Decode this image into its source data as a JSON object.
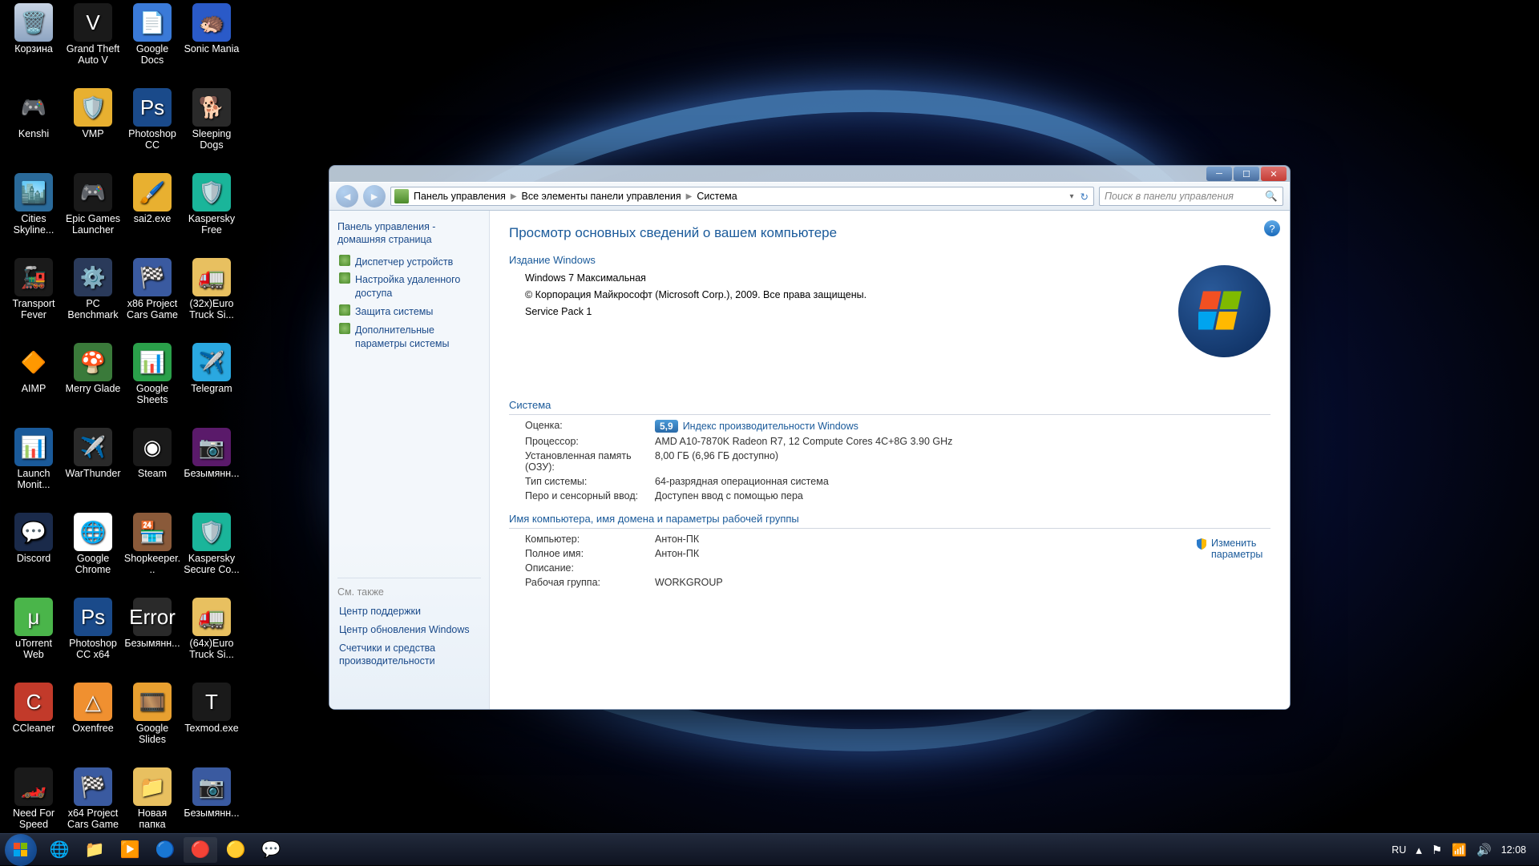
{
  "desktop_icons": [
    {
      "label": "Корзина",
      "bg": "linear-gradient(#c8d4e4,#8ea5c2)",
      "glyph": "🗑️"
    },
    {
      "label": "Kenshi",
      "bg": "#000",
      "glyph": "🎮"
    },
    {
      "label": "Cities Skyline...",
      "bg": "#2a6a9a",
      "glyph": "🏙️"
    },
    {
      "label": "Transport Fever",
      "bg": "#1a1a1a",
      "glyph": "🚂"
    },
    {
      "label": "AIMP",
      "bg": "#000",
      "glyph": "🔶"
    },
    {
      "label": "Launch Monit...",
      "bg": "#1a5a9a",
      "glyph": "📊"
    },
    {
      "label": "Discord",
      "bg": "#1a2a4a",
      "glyph": "💬"
    },
    {
      "label": "uTorrent Web",
      "bg": "#4ab54a",
      "glyph": "μ"
    },
    {
      "label": "CCleaner",
      "bg": "#c23a2a",
      "glyph": "C"
    },
    {
      "label": "Need For Speed Und...",
      "bg": "#1a1a1a",
      "glyph": "🏎️"
    },
    {
      "label": "Grand Theft Auto V",
      "bg": "#1a1a1a",
      "glyph": "V"
    },
    {
      "label": "VMP",
      "bg": "#e8b030",
      "glyph": "🛡️"
    },
    {
      "label": "Epic Games Launcher",
      "bg": "#1a1a1a",
      "glyph": "🎮"
    },
    {
      "label": "PC Benchmark",
      "bg": "#2a3a5a",
      "glyph": "⚙️"
    },
    {
      "label": "Merry Glade",
      "bg": "#3a7a3a",
      "glyph": "🍄"
    },
    {
      "label": "WarThunder",
      "bg": "#2a2a2a",
      "glyph": "✈️"
    },
    {
      "label": "Google Chrome",
      "bg": "#fff",
      "glyph": "🌐"
    },
    {
      "label": "Photoshop CC x64",
      "bg": "#1a4a8a",
      "glyph": "Ps"
    },
    {
      "label": "Oxenfree",
      "bg": "#f09030",
      "glyph": "△"
    },
    {
      "label": "x64 Project Cars Game ...",
      "bg": "#3a5aa0",
      "glyph": "🏁"
    },
    {
      "label": "Google Docs",
      "bg": "#3a7ad8",
      "glyph": "📄"
    },
    {
      "label": "Photoshop CC",
      "bg": "#1a4a8a",
      "glyph": "Ps"
    },
    {
      "label": "sai2.exe",
      "bg": "#e8b030",
      "glyph": "🖌️"
    },
    {
      "label": "x86 Project Cars Game ...",
      "bg": "#3a5aa0",
      "glyph": "🏁"
    },
    {
      "label": "Google Sheets",
      "bg": "#2aa04a",
      "glyph": "📊"
    },
    {
      "label": "Steam",
      "bg": "#1a1a1a",
      "glyph": "◉"
    },
    {
      "label": "Shopkeeper...",
      "bg": "#8a5a3a",
      "glyph": "🏪"
    },
    {
      "label": "Безымянн...",
      "bg": "#2a2a2a",
      "glyph": "Error"
    },
    {
      "label": "Google Slides",
      "bg": "#e8a030",
      "glyph": "🎞️"
    },
    {
      "label": "Новая папка",
      "bg": "#e8c060",
      "glyph": "📁"
    },
    {
      "label": "Sonic Mania",
      "bg": "#2a5ac8",
      "glyph": "🦔"
    },
    {
      "label": "Sleeping Dogs",
      "bg": "#2a2a2a",
      "glyph": "🐕"
    },
    {
      "label": "Kaspersky Free",
      "bg": "#1ab59a",
      "glyph": "🛡️"
    },
    {
      "label": "(32x)Euro Truck Si...",
      "bg": "#e8c060",
      "glyph": "🚛"
    },
    {
      "label": "Telegram",
      "bg": "#2aa8e0",
      "glyph": "✈️"
    },
    {
      "label": "Безымянн...",
      "bg": "#5a1a6a",
      "glyph": "📷"
    },
    {
      "label": "Kaspersky Secure Co...",
      "bg": "#1ab59a",
      "glyph": "🛡️"
    },
    {
      "label": "(64x)Euro Truck Si...",
      "bg": "#e8c060",
      "glyph": "🚛"
    },
    {
      "label": "Texmod.exe",
      "bg": "#1a1a1a",
      "glyph": "T"
    },
    {
      "label": "Безымянн...",
      "bg": "#3a5aa0",
      "glyph": "📷"
    }
  ],
  "breadcrumb": {
    "items": [
      "Панель управления",
      "Все элементы панели управления",
      "Система"
    ]
  },
  "search_placeholder": "Поиск в панели управления",
  "sidebar": {
    "home": "Панель управления - домашняя страница",
    "items": [
      "Диспетчер устройств",
      "Настройка удаленного доступа",
      "Защита системы",
      "Дополнительные параметры системы"
    ],
    "seealso_title": "См. также",
    "seealso": [
      "Центр поддержки",
      "Центр обновления Windows",
      "Счетчики и средства производительности"
    ]
  },
  "content": {
    "heading": "Просмотр основных сведений о вашем компьютере",
    "edition_title": "Издание Windows",
    "edition_name": "Windows 7 Максимальная",
    "copyright": "© Корпорация Майкрософт (Microsoft Corp.), 2009. Все права защищены.",
    "sp": "Service Pack 1",
    "system_title": "Система",
    "rating_label": "Оценка:",
    "rating_value": "5,9",
    "rating_link": "Индекс производительности Windows",
    "cpu_label": "Процессор:",
    "cpu_value": "AMD A10-7870K Radeon R7, 12 Compute Cores 4C+8G   3.90 GHz",
    "ram_label": "Установленная память (ОЗУ):",
    "ram_value": "8,00 ГБ (6,96 ГБ доступно)",
    "systype_label": "Тип системы:",
    "systype_value": "64-разрядная операционная система",
    "pen_label": "Перо и сенсорный ввод:",
    "pen_value": "Доступен ввод с помощью пера",
    "netgroup_title": "Имя компьютера, имя домена и параметры рабочей группы",
    "comp_label": "Компьютер:",
    "comp_value": "Антон-ПК",
    "full_label": "Полное имя:",
    "full_value": "Антон-ПК",
    "desc_label": "Описание:",
    "desc_value": "",
    "wg_label": "Рабочая группа:",
    "wg_value": "WORKGROUP",
    "change_link": "Изменить параметры"
  },
  "taskbar": {
    "lang": "RU",
    "time": "12:08"
  }
}
